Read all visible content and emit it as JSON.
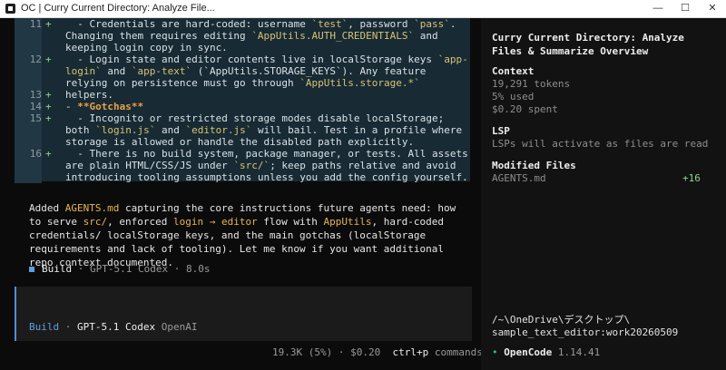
{
  "window": {
    "title": "OC | Curry Current Directory: Analyze File...",
    "min_symbol": "—",
    "max_symbol": "☐",
    "close_symbol": "✕"
  },
  "diff": {
    "lines": [
      {
        "num": "11",
        "plus": "+",
        "parts": [
          {
            "t": "  - Credentials are hard-coded: username ",
            "c": ""
          },
          {
            "t": "`test`",
            "c": "code"
          },
          {
            "t": ", password ",
            "c": ""
          },
          {
            "t": "`pass`",
            "c": "code"
          },
          {
            "t": ". Changing them requires editing ",
            "c": ""
          },
          {
            "t": "`AppUtils.AUTH_CREDENTIALS`",
            "c": "code"
          },
          {
            "t": " and keeping login copy in sync.",
            "c": ""
          }
        ]
      },
      {
        "num": "12",
        "plus": "+",
        "parts": [
          {
            "t": "  - Login state and editor contents live in localStorage keys ",
            "c": ""
          },
          {
            "t": "`app-login`",
            "c": "code"
          },
          {
            "t": " and ",
            "c": ""
          },
          {
            "t": "`app-text`",
            "c": "code"
          },
          {
            "t": " (`AppUtils.STORAGE_KEYS`). Any feature relying on persistence must go through ",
            "c": ""
          },
          {
            "t": "`AppUtils.storage.*`",
            "c": "code"
          },
          {
            "t": " helpers.",
            "c": ""
          }
        ]
      },
      {
        "num": "13",
        "plus": "+",
        "parts": []
      },
      {
        "num": "14",
        "plus": "+",
        "parts": [
          {
            "t": "- ",
            "c": ""
          },
          {
            "t": "**Gotchas**",
            "c": "orange"
          }
        ]
      },
      {
        "num": "15",
        "plus": "+",
        "parts": [
          {
            "t": "  - Incognito or restricted storage modes disable localStorage; both ",
            "c": ""
          },
          {
            "t": "`login.js`",
            "c": "code"
          },
          {
            "t": " and ",
            "c": ""
          },
          {
            "t": "`editor.js`",
            "c": "code"
          },
          {
            "t": " will bail. Test in a profile where storage is allowed or handle the disabled path explicitly.",
            "c": ""
          }
        ]
      },
      {
        "num": "16",
        "plus": "+",
        "parts": [
          {
            "t": "  - There is no build system, package manager, or tests. All assets are plain HTML/CSS/JS under ",
            "c": ""
          },
          {
            "t": "`src/`",
            "c": "code"
          },
          {
            "t": "; keep paths relative and avoid introducing tooling assumptions unless you add the config yourself.",
            "c": ""
          }
        ]
      }
    ]
  },
  "summary": {
    "parts": [
      {
        "t": "Added ",
        "c": ""
      },
      {
        "t": "AGENTS.md",
        "c": "hl"
      },
      {
        "t": " capturing the core instructions future agents need: how to serve ",
        "c": ""
      },
      {
        "t": "src/",
        "c": "hl"
      },
      {
        "t": ", enforced ",
        "c": ""
      },
      {
        "t": "login → editor",
        "c": "hl"
      },
      {
        "t": " flow with ",
        "c": ""
      },
      {
        "t": "AppUtils",
        "c": "hl"
      },
      {
        "t": ", hard-coded credentials/ localStorage keys, and the main gotchas (localStorage requirements and lack of tooling). Let me know if you want additional repo context documented.",
        "c": ""
      }
    ]
  },
  "build_status": {
    "label": "Build",
    "model": "GPT-5.1 Codex",
    "duration": "8.0s",
    "sep": "·"
  },
  "input": {
    "mode": "Build",
    "model": "GPT-5.1 Codex",
    "provider": "OpenAI",
    "sep": "·"
  },
  "footer": {
    "tokens": "19.3K (5%)",
    "cost": "$0.20",
    "shortcut": "ctrl+p",
    "shortcut_label": "commands",
    "sep": "·"
  },
  "sidebar": {
    "title": "Curry Current Directory: Analyze Files & Summarize Overview",
    "context_heading": "Context",
    "tokens": "19,291 tokens",
    "used": "5% used",
    "spent": "$0.20 spent",
    "lsp_heading": "LSP",
    "lsp_text": "LSPs will activate as files are read",
    "modified_heading": "Modified Files",
    "modified_file": "AGENTS.md",
    "modified_added": "+16",
    "path": "/~\\OneDrive\\デスクトップ\\ sample_text_editor:work20260509",
    "app_name": "OpenCode",
    "version": "1.14.41",
    "status_dot": "•"
  },
  "colors": {
    "accent_blue": "#4d8fd6",
    "diff_bg": "#182a33",
    "code_yellow": "#d7c276",
    "added_green": "#8fd38f",
    "online_dot": "#2fbf71"
  }
}
